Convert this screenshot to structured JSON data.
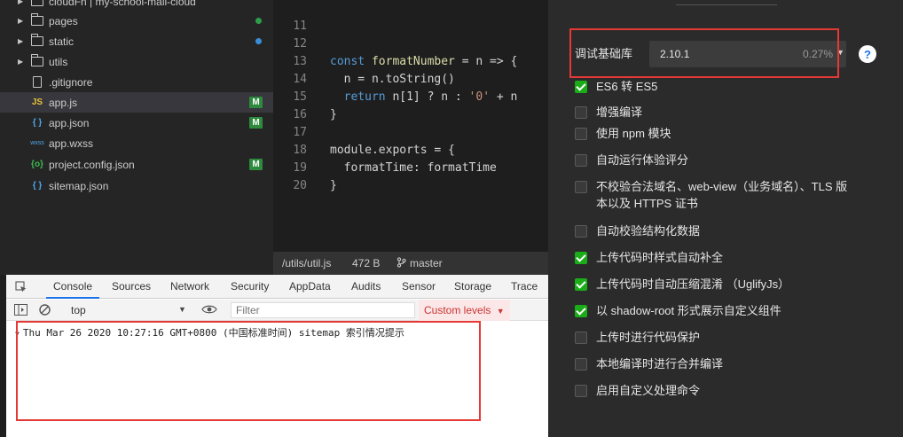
{
  "explorer": {
    "top_partial": "cloudFn | my-school-mall-cloud",
    "items": [
      {
        "name": "pages",
        "kind": "folder",
        "status": "dot-green"
      },
      {
        "name": "static",
        "kind": "folder",
        "status": "dot-blue"
      },
      {
        "name": "utils",
        "kind": "folder",
        "status": ""
      },
      {
        "name": ".gitignore",
        "kind": "file",
        "icon_text": "",
        "status": ""
      },
      {
        "name": "app.js",
        "kind": "file",
        "icon_text": "JS",
        "status": "M"
      },
      {
        "name": "app.json",
        "kind": "file",
        "icon_text": "{ }",
        "status": "M"
      },
      {
        "name": "app.wxss",
        "kind": "file",
        "icon_text": "wxss",
        "status": ""
      },
      {
        "name": "project.config.json",
        "kind": "file",
        "icon_text": "{o}",
        "status": "M"
      },
      {
        "name": "sitemap.json",
        "kind": "file",
        "icon_text": "{ }",
        "status": ""
      }
    ],
    "colors": {
      "dot_green": "#2e9e4a",
      "dot_blue": "#3a8ed8",
      "modified": "#2e8a3c"
    }
  },
  "editor": {
    "line_numbers": [
      "11",
      "12",
      "13",
      "14",
      "15",
      "16",
      "17",
      "18",
      "19",
      "20"
    ],
    "lines": {
      "l12_kw": "const",
      "l12_name": " formatNumber ",
      "l12_rest": "= n => {",
      "l13": "  n = n.toString()",
      "l14_kw": "  return",
      "l14_mid": " n[1] ? n : ",
      "l14_str": "'0'",
      "l14_end": " + n",
      "l15": "}",
      "l17": "module.exports = {",
      "l18": "  formatTime: formatTime",
      "l19": "}"
    }
  },
  "statusbar": {
    "path": "/utils/util.js",
    "size": "472 B",
    "branch_icon": "git-branch-icon",
    "branch": "master"
  },
  "devtools": {
    "tabs": [
      "Console",
      "Sources",
      "Network",
      "Security",
      "AppData",
      "Audits",
      "Sensor",
      "Storage",
      "Trace"
    ],
    "active_tab": "Console",
    "context": "top",
    "filter_placeholder": "Filter",
    "levels": "Custom levels",
    "console_message": "Thu Mar 26 2020 10:27:16 GMT+0800 (中国标准时间) sitemap 索引情况提示"
  },
  "settings": {
    "lib_label": "调试基础库",
    "lib_version": "2.10.1",
    "lib_percent": "0.27%",
    "help": "?",
    "options": [
      {
        "label": "ES6 转 ES5",
        "checked": true
      },
      {
        "label": "增强编译",
        "checked": false
      },
      {
        "label": "使用 npm 模块",
        "checked": false
      },
      {
        "label": "自动运行体验评分",
        "checked": false
      },
      {
        "label": "不校验合法域名、web-view（业务域名）、TLS 版",
        "label2": "本以及 HTTPS 证书",
        "checked": false
      },
      {
        "label": "自动校验结构化数据",
        "checked": false
      },
      {
        "label": "上传代码时样式自动补全",
        "checked": true
      },
      {
        "label": "上传代码时自动压缩混淆 （UglifyJs）",
        "checked": true
      },
      {
        "label": "以 shadow-root 形式展示自定义组件",
        "checked": true
      },
      {
        "label": "上传时进行代码保护",
        "checked": false
      },
      {
        "label": "本地编译时进行合并编译",
        "checked": false
      },
      {
        "label": "启用自定义处理命令",
        "checked": false
      }
    ],
    "colors": {
      "check": "#1aad19",
      "help": "#1a73e8",
      "highlight": "#e53935"
    }
  }
}
